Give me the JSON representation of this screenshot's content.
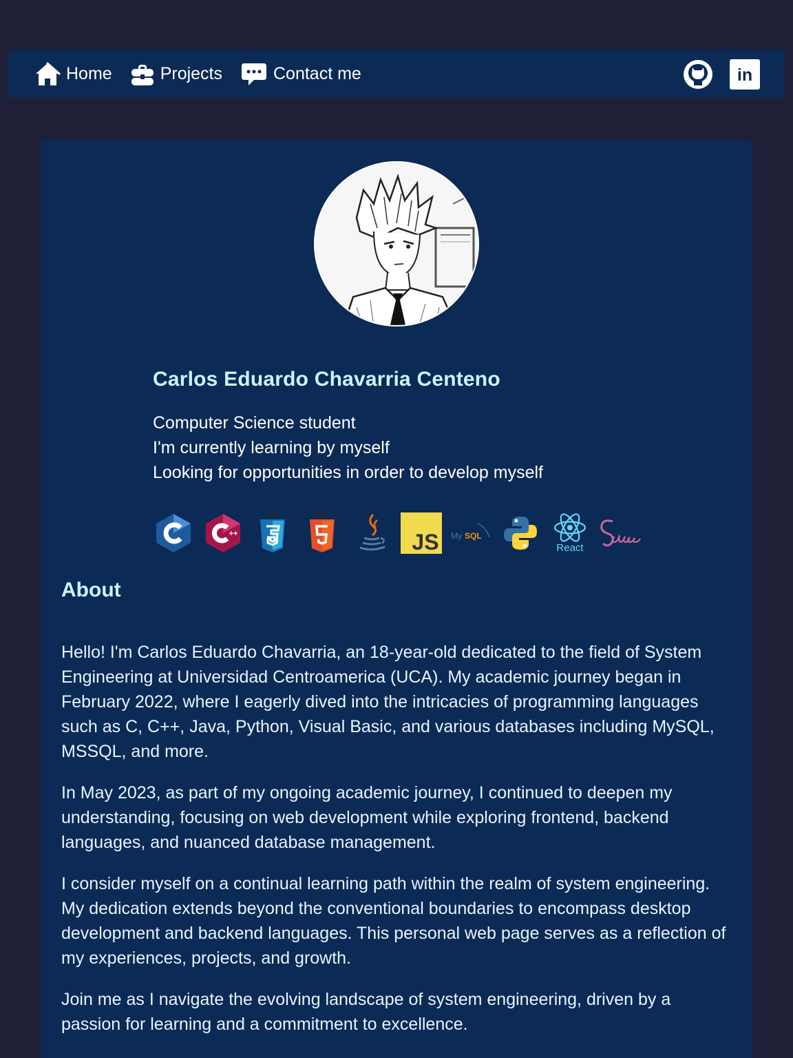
{
  "nav": {
    "home_label": "Home",
    "projects_label": "Projects",
    "contact_label": "Contact me",
    "social": {
      "github_icon": "github-icon",
      "linkedin_text": "in"
    }
  },
  "profile": {
    "name": "Carlos Eduardo Chavarria Centeno",
    "tagline": [
      "Computer Science student",
      "I'm currently learning by myself",
      "Looking for opportunities in order to develop myself"
    ]
  },
  "techs": {
    "items": [
      "C",
      "C++",
      "CSS3",
      "HTML5",
      "Java",
      "JavaScript",
      "MySQL",
      "Python",
      "React",
      "Sass"
    ],
    "react_label": "React",
    "css_badge": "CSS",
    "html_badge": "HTML",
    "mysql_label": "MySQL",
    "js_label": "JS"
  },
  "about": {
    "title": "About",
    "paragraphs": [
      "Hello! I'm Carlos Eduardo Chavarria, an 18-year-old dedicated to the field of System Engineering at Universidad Centroamerica (UCA). My academic journey began in February 2022, where I eagerly dived into the intricacies of programming languages such as C, C++, Java, Python, Visual Basic, and various databases including MySQL, MSSQL, and more.",
      "In May 2023, as part of my ongoing academic journey, I continued to deepen my understanding, focusing on web development while exploring frontend, backend languages, and nuanced database management.",
      "I consider myself on a continual learning path within the realm of system engineering. My dedication extends beyond the conventional boundaries to encompass desktop development and backend languages. This personal web page serves as a reflection of my experiences, projects, and growth.",
      "Join me as I navigate the evolving landscape of system engineering, driven by a passion for learning and a commitment to excellence."
    ]
  },
  "colors": {
    "page_bg": "#201f38",
    "panel_bg": "#0b2a55",
    "heading": "#cdf3ff",
    "text": "#ffffff"
  }
}
